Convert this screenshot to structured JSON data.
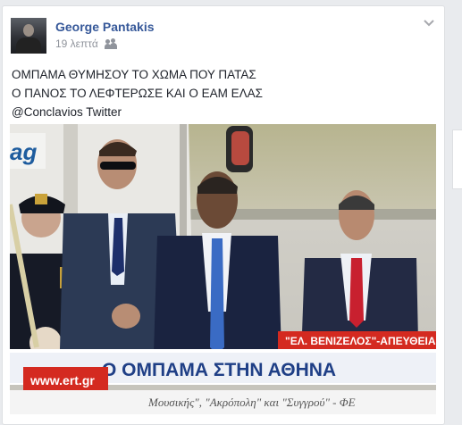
{
  "post": {
    "author": "George Pantakis",
    "time": "19 λεπτά",
    "lines": [
      "ΟΜΠΑΜΑ ΘΥΜΗΣΟΥ ΤΟ ΧΩΜΑ ΠΟΥ ΠΑΤΑΣ",
      "Ο ΠΑΝΟΣ ΤΟ ΛΕΦΤΕΡΩΣΕ ΚΑΙ Ο ΕΑΜ ΕΛΑΣ",
      "@Conclavios Twitter"
    ]
  },
  "photo": {
    "plane_logo": "ag",
    "caption_strip": "\"ΕΛ. ΒΕΝΙΖΕΛΟΣ\"-ΑΠΕΥΘΕΙΑΣ. Κ. Λ",
    "headline": "Ο ΟΜΠΑΜΑ ΣΤΗΝ ΑΘΗΝΑ",
    "channel": "www.ert.gr",
    "ticker": "Μουσικής\",   \"Ακρόπολη\"   και   \"Συγγρού\"  - ΦΕ"
  },
  "colors": {
    "link": "#365899",
    "ticker_red": "#d42a20",
    "headline_blue": "#1f3f86"
  },
  "icons": [
    "friends-icon",
    "chevron-down-icon"
  ]
}
